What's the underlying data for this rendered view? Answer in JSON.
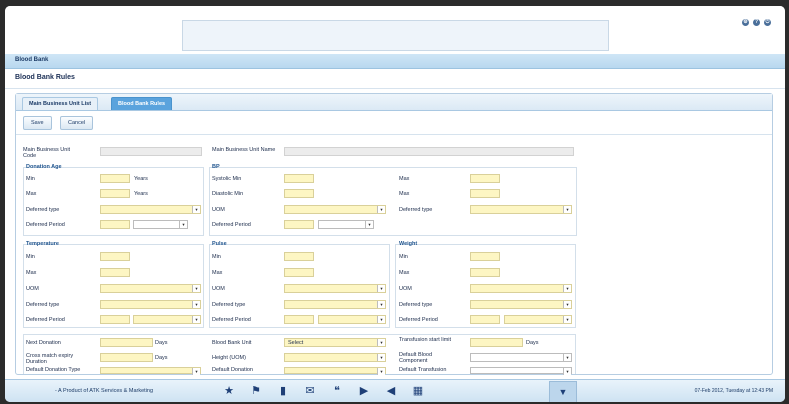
{
  "module": "Blood Bank",
  "page_title": "Blood Bank Rules",
  "tabs": [
    {
      "label": "Main Business Unit List"
    },
    {
      "label": "Blood Bank Rules"
    }
  ],
  "buttons": {
    "save": "Save",
    "cancel": "Cancel"
  },
  "header_fields": {
    "code_label": "Main Business Unit Code",
    "name_label": "Main Business Unit Name"
  },
  "donation_age": {
    "title": "Donation Age",
    "min": "Min",
    "max": "Max",
    "years": "Years",
    "deferred_type": "Deferred type",
    "deferred_period": "Deferred Period"
  },
  "bp": {
    "title": "BP",
    "systolic_min": "Systolic Min",
    "diastolic_min": "Diastolic Min",
    "uom": "UOM",
    "deferred_period": "Deferred Period",
    "max": "Max",
    "deferred_type": "Deferred type"
  },
  "temperature": {
    "title": "Temperature",
    "min": "Min",
    "max": "Max",
    "uom": "UOM",
    "deferred_type": "Deferred type",
    "deferred_period": "Deferred Period"
  },
  "pulse": {
    "title": "Pulse",
    "min": "Min",
    "max": "Max",
    "uom": "UOM",
    "deferred_type": "Deferred type",
    "deferred_period": "Deferred Period"
  },
  "weight": {
    "title": "Weight",
    "min": "Min",
    "max": "Max",
    "uom": "UOM",
    "deferred_type": "Deferred type",
    "deferred_period": "Deferred Period"
  },
  "misc": {
    "next_donation": "Next Donation",
    "days": "Days",
    "cross_match": "Cross match expiry Duration",
    "default_donation_type": "Default Donation Type",
    "blood_bank_unit": "Blood Bank Unit",
    "select": "Select",
    "height_uom": "Height (UOM)",
    "default_donation": "Default Donation",
    "transfusion_start_limit": "Transfusion start limit",
    "default_blood_component": "Default Blood Component",
    "default_transfusion": "Default Transfusion"
  },
  "footer": {
    "product": "- A Product of ATK Services & Marketing",
    "datetime": "07-Feb 2012, Tuesday at 12:43 PM"
  },
  "top_icons": [
    "gear-icon",
    "help-icon",
    "power-icon"
  ],
  "footer_icons": [
    "star-icon",
    "flag-icon",
    "book-icon",
    "mail-icon",
    "chat-icon",
    "video-icon",
    "speaker-icon",
    "calendar-icon"
  ],
  "colors": {
    "accent": "#5aa3dd",
    "field_required": "#fdf6c3",
    "header_bar": "#cfe6f6"
  }
}
